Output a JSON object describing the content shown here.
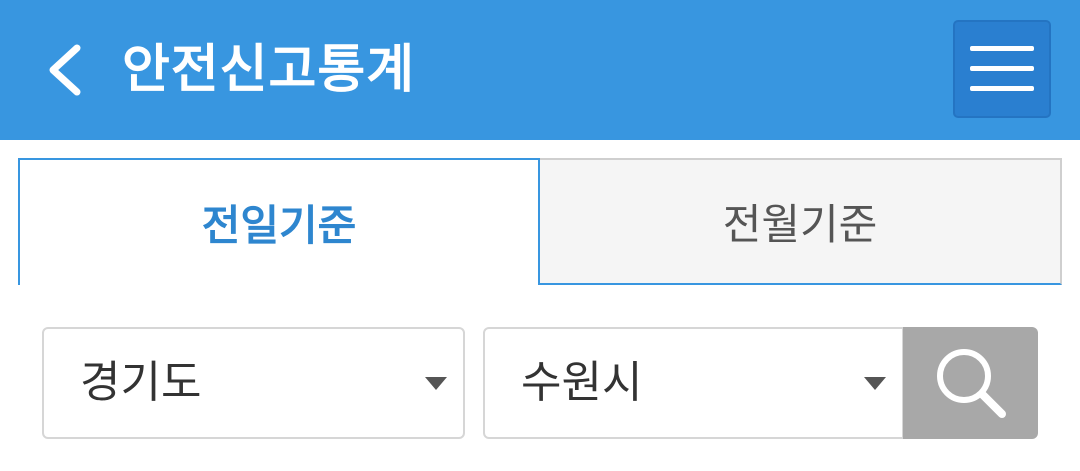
{
  "header": {
    "title": "안전신고통계",
    "back_icon": "chevron-left-icon",
    "menu_icon": "hamburger-menu-icon",
    "bg_color": "#3896e0"
  },
  "tabs": [
    {
      "label": "전일기준",
      "active": true
    },
    {
      "label": "전월기준",
      "active": false
    }
  ],
  "filters": {
    "province": {
      "selected": "경기도"
    },
    "city": {
      "selected": "수원시"
    },
    "search_icon": "search-icon"
  },
  "colors": {
    "accent": "#3896e0",
    "active_tab_text": "#2e86cf",
    "search_button": "#a8a8a8"
  }
}
